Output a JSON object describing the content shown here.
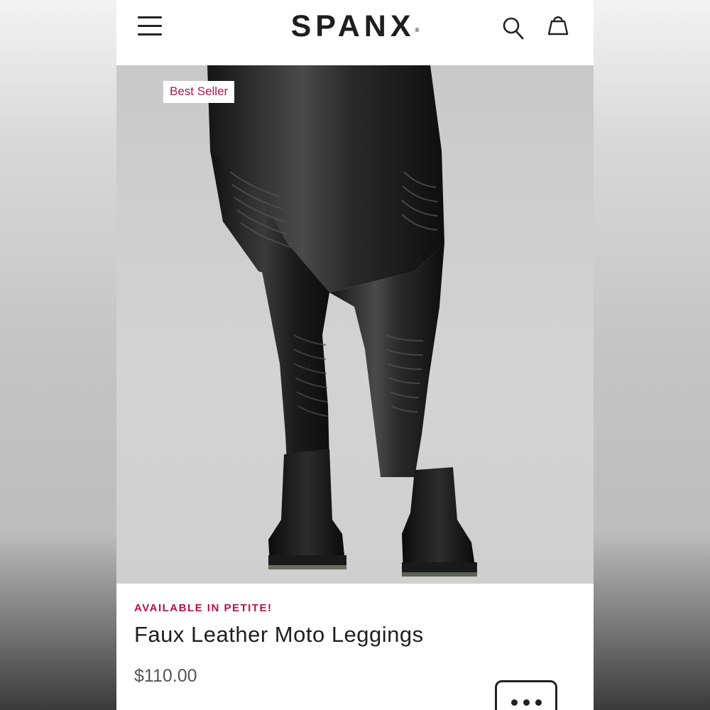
{
  "header": {
    "brand": "SPANX",
    "brand_mark": "®",
    "menu_icon": "hamburger-menu-icon",
    "search_icon": "search-icon",
    "bag_icon": "shopping-bag-icon"
  },
  "product": {
    "badge": "Best Seller",
    "availability": "AVAILABLE IN PETITE!",
    "name": "Faux Leather Moto Leggings",
    "price": "$110.00",
    "image_alt": "model wearing black faux leather moto leggings with black boots"
  },
  "actions": {
    "more_icon": "ellipsis-icon"
  },
  "colors": {
    "accent": "#b0154a",
    "text": "#1f1f1f",
    "price": "#555555"
  }
}
